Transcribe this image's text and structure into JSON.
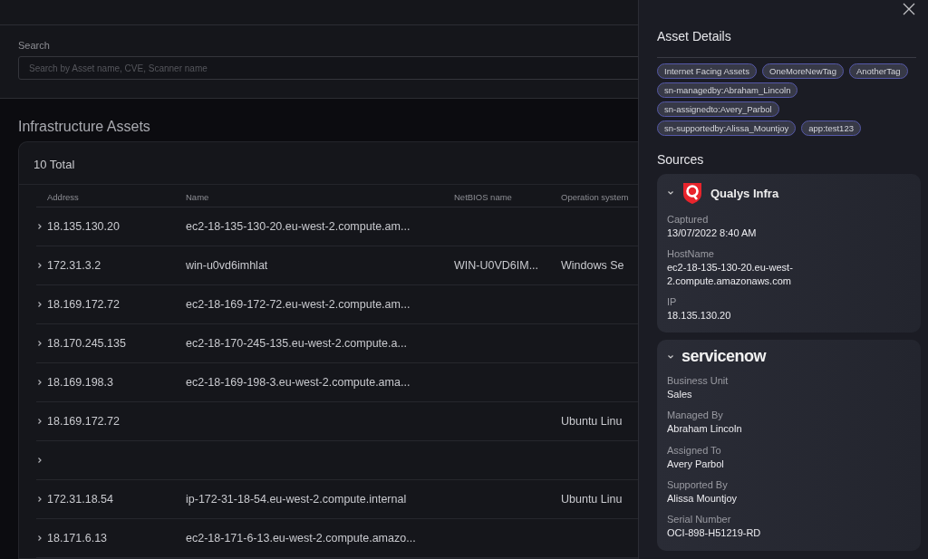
{
  "search": {
    "label": "Search",
    "placeholder": "Search by Asset name, CVE, Scanner name"
  },
  "assets": {
    "title": "Infrastructure Assets",
    "total": "10 Total",
    "columns": [
      "Address",
      "Name",
      "NetBIOS name",
      "Operation system"
    ],
    "rows": [
      {
        "expanded": false,
        "address": "18.135.130.20",
        "name": "ec2-18-135-130-20.eu-west-2.compute.am..."
      },
      {
        "expanded": false,
        "address": "172.31.3.2",
        "name": "win-u0vd6imhlat",
        "netbios": "WIN-U0VD6IM...",
        "os": "Windows Se"
      },
      {
        "expanded": false,
        "address": "18.169.172.72",
        "name": "ec2-18-169-172-72.eu-west-2.compute.am..."
      },
      {
        "expanded": false,
        "address": "18.170.245.135",
        "name": "ec2-18-170-245-135.eu-west-2.compute.a..."
      },
      {
        "expanded": false,
        "address": "18.169.198.3",
        "name": "ec2-18-169-198-3.eu-west-2.compute.ama..."
      },
      {
        "expanded": false,
        "address": "18.169.172.72",
        "os": "Ubuntu Linu"
      },
      {
        "expanded": false
      },
      {
        "expanded": false,
        "address": "172.31.18.54",
        "name": "ip-172-31-18-54.eu-west-2.compute.internal",
        "os": "Ubuntu Linu"
      },
      {
        "expanded": false,
        "address": "18.171.6.13",
        "name": "ec2-18-171-6-13.eu-west-2.compute.amazo..."
      }
    ]
  },
  "drawer": {
    "title": "Asset Details",
    "tags": [
      "Internet Facing Assets",
      "OneMoreNewTag",
      "AnotherTag",
      "sn-managedby:Abraham_Lincoln",
      "sn-assignedto:Avery_Parbol",
      "sn-supportedby:Alissa_Mountjoy",
      "app:test123"
    ],
    "sources_title": "Sources",
    "sources": [
      {
        "kind": "qualys",
        "expanded": true,
        "name": "Qualys Infra",
        "fields": [
          {
            "label": "Captured",
            "value": "13/07/2022 8:40 AM"
          },
          {
            "label": "HostName",
            "value": "ec2-18-135-130-20.eu-west-2.compute.amazonaws.com"
          },
          {
            "label": "IP",
            "value": "18.135.130.20"
          }
        ]
      },
      {
        "kind": "servicenow",
        "expanded": true,
        "name": "servicenow",
        "fields": [
          {
            "label": "Business Unit",
            "value": "Sales"
          },
          {
            "label": "Managed By",
            "value": "Abraham Lincoln"
          },
          {
            "label": "Assigned To",
            "value": "Avery Parbol"
          },
          {
            "label": "Supported By",
            "value": "Alissa Mountjoy"
          },
          {
            "label": "Serial Number",
            "value": "OCI-898-H51219-RD"
          }
        ]
      }
    ]
  }
}
